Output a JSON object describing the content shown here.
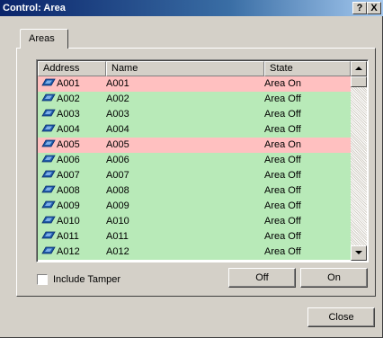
{
  "window": {
    "title": "Control: Area",
    "help_label": "?",
    "close_label": "X"
  },
  "tabs": [
    {
      "label": "Areas"
    }
  ],
  "table": {
    "columns": [
      "Address",
      "Name",
      "State"
    ],
    "rows": [
      {
        "address": "A001",
        "name": "A001",
        "state": "Area On"
      },
      {
        "address": "A002",
        "name": "A002",
        "state": "Area Off"
      },
      {
        "address": "A003",
        "name": "A003",
        "state": "Area Off"
      },
      {
        "address": "A004",
        "name": "A004",
        "state": "Area Off"
      },
      {
        "address": "A005",
        "name": "A005",
        "state": "Area On"
      },
      {
        "address": "A006",
        "name": "A006",
        "state": "Area Off"
      },
      {
        "address": "A007",
        "name": "A007",
        "state": "Area Off"
      },
      {
        "address": "A008",
        "name": "A008",
        "state": "Area Off"
      },
      {
        "address": "A009",
        "name": "A009",
        "state": "Area Off"
      },
      {
        "address": "A010",
        "name": "A010",
        "state": "Area Off"
      },
      {
        "address": "A011",
        "name": "A011",
        "state": "Area Off"
      },
      {
        "address": "A012",
        "name": "A012",
        "state": "Area Off"
      }
    ],
    "row_icon": "area-icon"
  },
  "colors": {
    "state_on": "#ffc0c0",
    "state_off": "#b8eab8",
    "titlebar": "#0a246a"
  },
  "include_tamper": {
    "label": "Include Tamper",
    "checked": false
  },
  "buttons": {
    "off_label": "Off",
    "on_label": "On",
    "close_label": "Close"
  }
}
